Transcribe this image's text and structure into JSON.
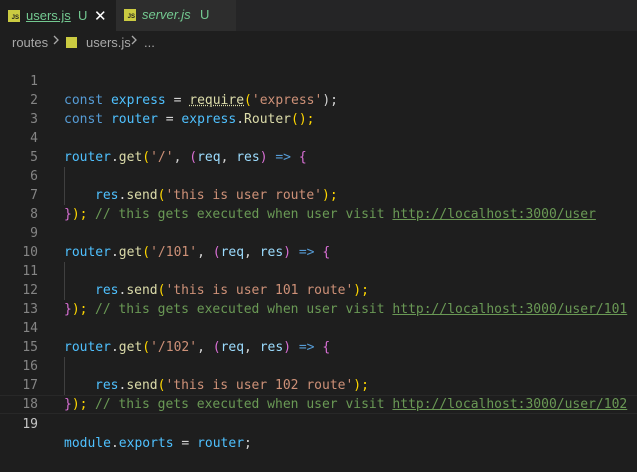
{
  "tabs": [
    {
      "label": "users.js",
      "badge": "U",
      "close": "✕",
      "icon_text": "JS"
    },
    {
      "label": "server.js",
      "badge": "U",
      "icon_text": "JS"
    }
  ],
  "breadcrumb": {
    "folder": "routes",
    "file": "users.js",
    "ellipsis": "..."
  },
  "editor": {
    "current_line": 19,
    "line_numbers": [
      "1",
      "2",
      "3",
      "4",
      "5",
      "6",
      "7",
      "8",
      "9",
      "10",
      "11",
      "12",
      "13",
      "14",
      "15",
      "16",
      "17",
      "18",
      "19"
    ],
    "code": {
      "l1": [
        "const",
        "express",
        "=",
        "require",
        "(",
        "'express'",
        ");"
      ],
      "l2": [
        "const",
        "router",
        "=",
        "express",
        ".",
        "Router",
        "();"
      ],
      "l4": [
        "router",
        ".",
        "get",
        "(",
        "'/'",
        ", ",
        "(",
        "req",
        ", ",
        "res",
        ")",
        " => ",
        "{"
      ],
      "l5": [
        "res",
        ".",
        "send",
        "(",
        "'this is user route'",
        ");"
      ],
      "l6": [
        "// this gets executed when user visit ",
        "http://localhost:3000/user"
      ],
      "l7": [
        "}",
        ");"
      ],
      "l9": [
        "router",
        ".",
        "get",
        "(",
        "'/101'",
        ", ",
        "(",
        "req",
        ", ",
        "res",
        ")",
        " => ",
        "{"
      ],
      "l10": [
        "res",
        ".",
        "send",
        "(",
        "'this is user 101 route'",
        ");"
      ],
      "l11": [
        "// this gets executed when user visit ",
        "http://localhost:3000/user/101"
      ],
      "l12": [
        "}",
        ");"
      ],
      "l14": [
        "router",
        ".",
        "get",
        "(",
        "'/102'",
        ", ",
        "(",
        "req",
        ", ",
        "res",
        ")",
        " => ",
        "{"
      ],
      "l15": [
        "res",
        ".",
        "send",
        "(",
        "'this is user 102 route'",
        ");"
      ],
      "l16": [
        "// this gets executed when user visit ",
        "http://localhost:3000/user/102"
      ],
      "l17": [
        "}",
        ");"
      ],
      "l19": [
        "module",
        ".",
        "exports",
        " = ",
        "router",
        ";"
      ]
    }
  }
}
